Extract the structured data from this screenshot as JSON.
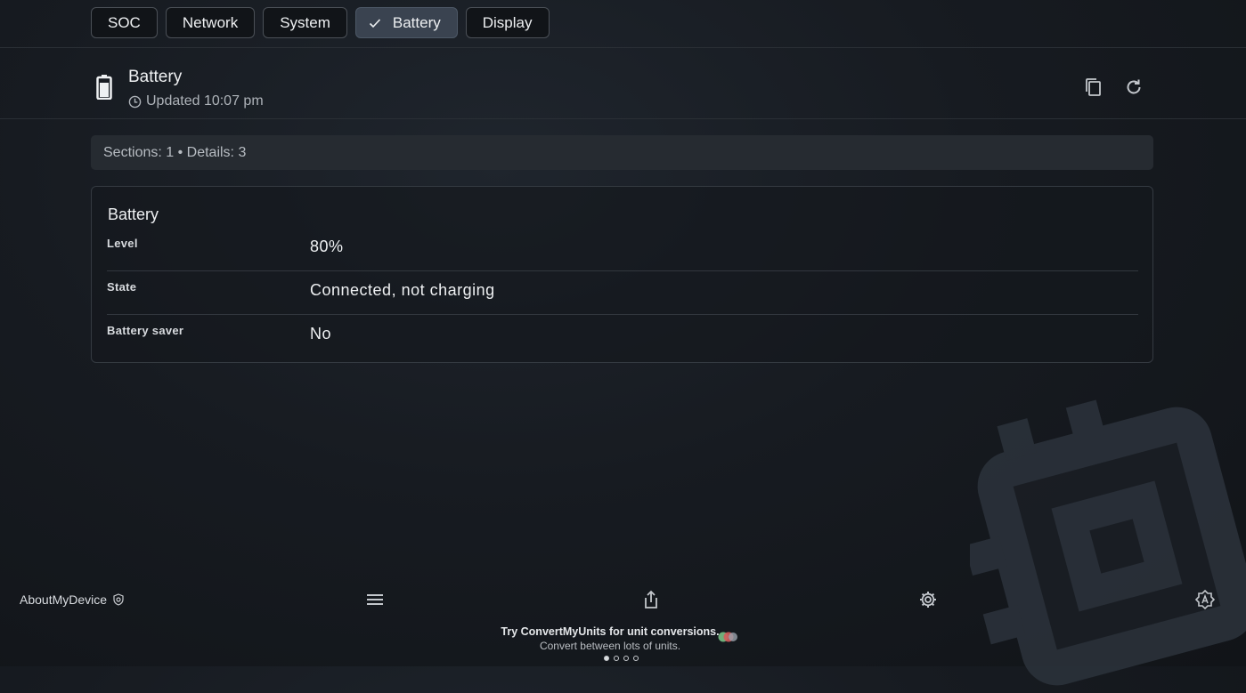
{
  "tabs": [
    {
      "label": "SOC",
      "active": false
    },
    {
      "label": "Network",
      "active": false
    },
    {
      "label": "System",
      "active": false
    },
    {
      "label": "Battery",
      "active": true
    },
    {
      "label": "Display",
      "active": false
    }
  ],
  "header": {
    "icon": "battery-icon",
    "title": "Battery",
    "updated": "Updated 10:07 pm",
    "actions": [
      "copy-icon",
      "refresh-icon"
    ]
  },
  "summary": "Sections: 1 • Details: 3",
  "section": {
    "title": "Battery",
    "rows": [
      {
        "label": "Level",
        "value": "80%"
      },
      {
        "label": "State",
        "value": "Connected, not charging"
      },
      {
        "label": "Battery saver",
        "value": "No"
      }
    ]
  },
  "bottom_bar": {
    "app_name": "AboutMyDevice",
    "app_badge_icon": "shield-icon",
    "icons": [
      "menu-icon",
      "share-icon",
      "settings-icon",
      "auto-brightness-icon"
    ]
  },
  "promo": {
    "title": "Try ConvertMyUnits for unit conversions.",
    "subtitle": "Convert between lots of units.",
    "page_count": 4,
    "active_page": 1
  },
  "colors": {
    "background": "#171b21",
    "active_tab": "#3a4350",
    "text": "#eef0f2",
    "muted_text": "#aeb3b9"
  }
}
